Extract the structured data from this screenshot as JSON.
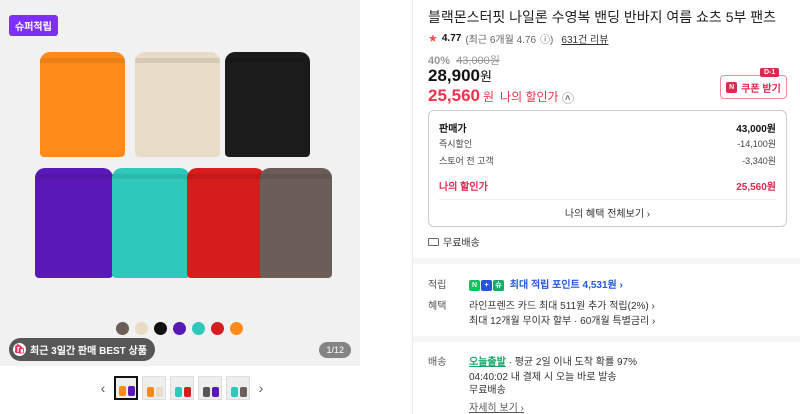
{
  "gallery": {
    "badge": "슈퍼적립",
    "best_label": "최근 3일간 판매 BEST 상품",
    "page_indicator": "1/12",
    "swatch_colors": [
      "#6b5d57",
      "#e8dcc6",
      "#111111",
      "#5a18b8",
      "#2fc9bc",
      "#d61c1c",
      "#ff8a1a"
    ],
    "short_colors": [
      "#ff8a1a",
      "#e8dcc6",
      "#1b1b1b",
      "#5a18b8",
      "#2fc9bc",
      "#d61c1c",
      "#6b5d57"
    ]
  },
  "product": {
    "title": "블랙몬스터핏 나일론 수영복 밴딩 반바지 여름 쇼츠 5부 팬츠",
    "rating": "4.77",
    "rating_recent": "(최근 6개월 4.76",
    "rating_info": "ⓘ)",
    "reviews": "631건 리뷰",
    "discount_pct": "40%",
    "original_price": "43,000원",
    "price": "28,900",
    "price_unit": "원",
    "my_price": "25,560",
    "my_price_unit": "원",
    "my_price_label": "나의 할인가",
    "coupon_label": "쿠폰 받기",
    "coupon_badge": "D-1"
  },
  "pricebox": {
    "rows": [
      {
        "label": "판매가",
        "value": "43,000원"
      },
      {
        "label": "즉시할인",
        "value": "-14,100원"
      },
      {
        "label": "스토어 전 고객",
        "value": "-3,340원"
      }
    ],
    "total_label": "나의 할인가",
    "total_value": "25,560원",
    "benefit_button": "나의 혜택 전체보기"
  },
  "shipping": {
    "free": "무료배송"
  },
  "benefits": {
    "points_label": "적립",
    "points_value": "최대 적립 포인트 4,531원",
    "benefit_label": "혜택",
    "benefit_line1": "라인프렌즈 카드 최대 511원 추가 적립(2%)",
    "benefit_line2": "최대 12개월 무이자 할부 · 60개월 특별금리"
  },
  "delivery": {
    "label": "배송",
    "today": "오늘출발",
    "today_desc": "· 평균 2일 이내 도착 확률 97%",
    "cutoff": "04:40:02  내 결제 시 오늘 바로 발송",
    "free": "무료배송",
    "more": "자세히 보기"
  }
}
